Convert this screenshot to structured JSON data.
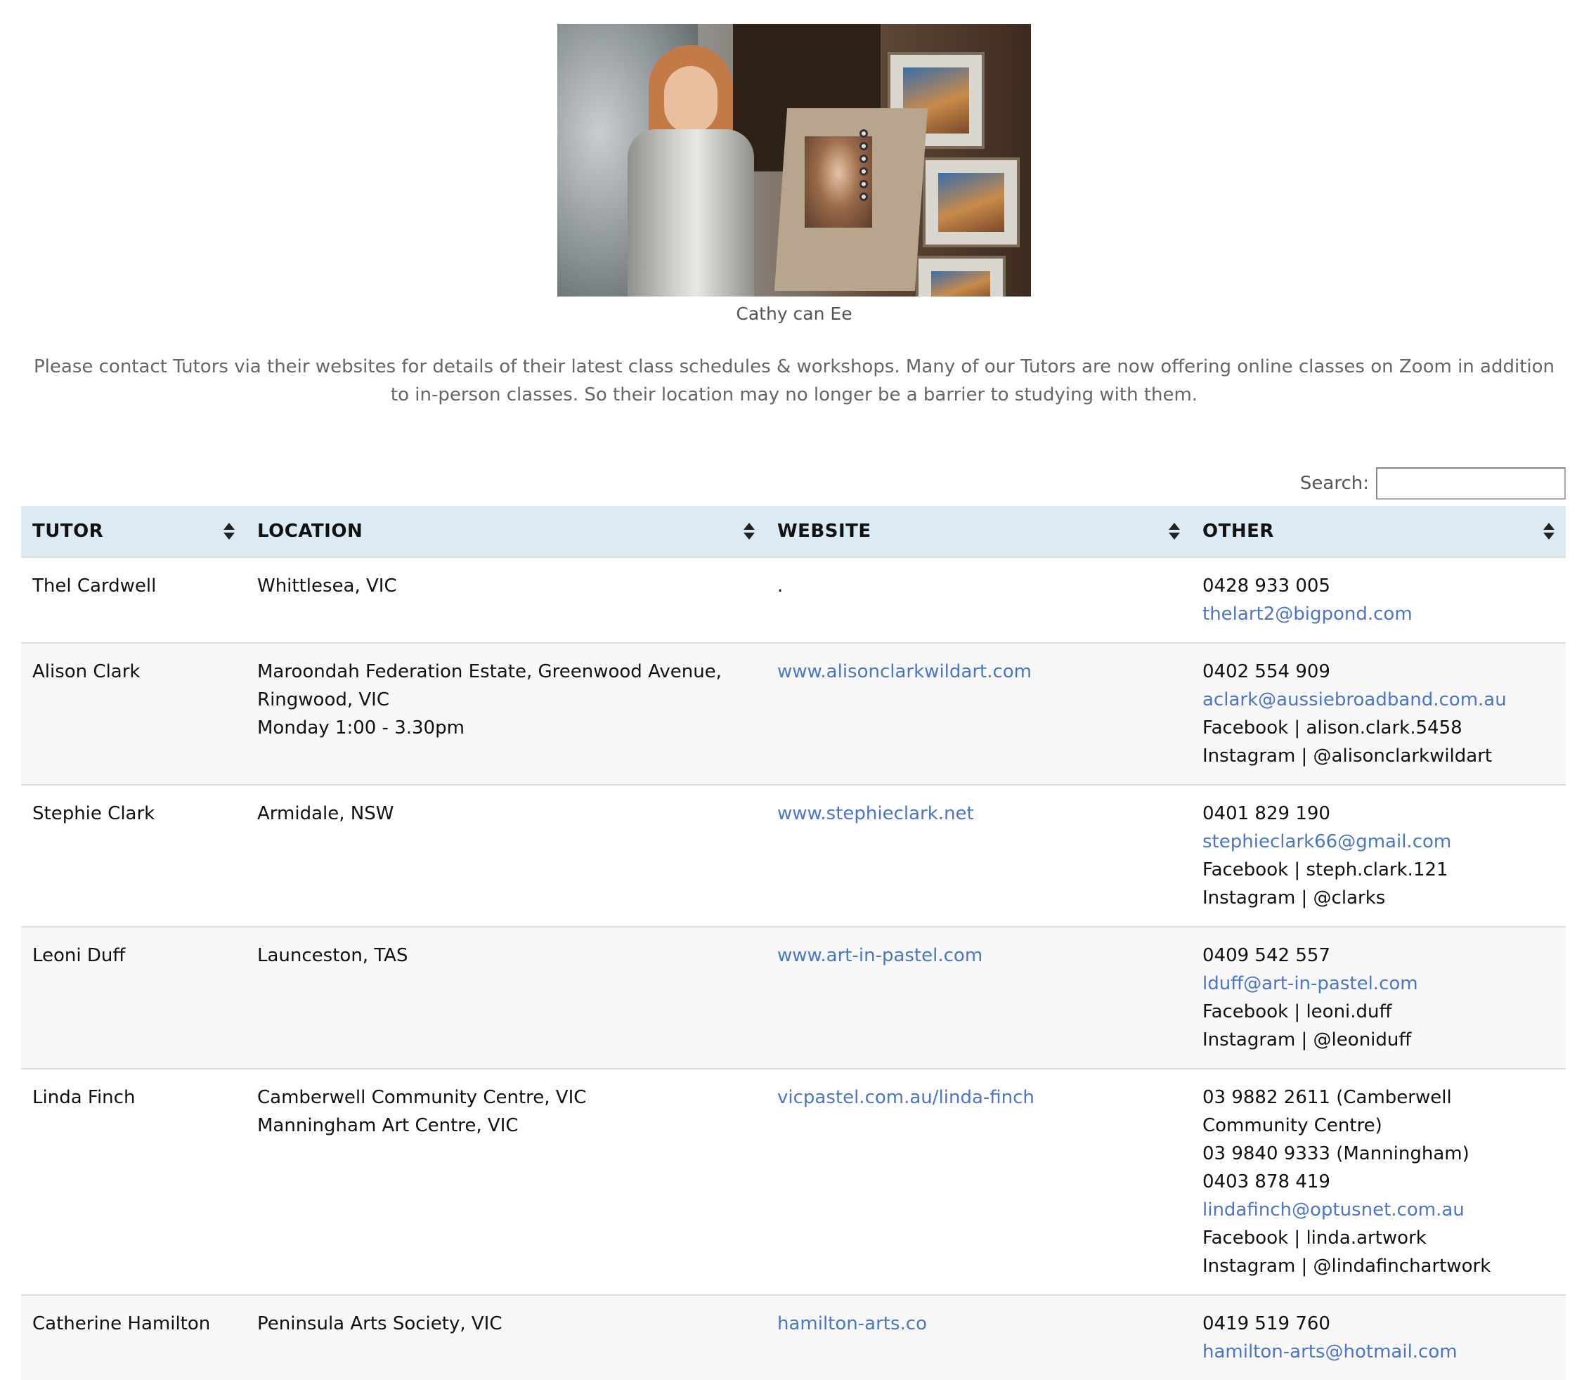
{
  "figure": {
    "caption": "Cathy can Ee"
  },
  "notice": "Please contact Tutors via their websites for details of their latest class schedules & workshops. Many of our Tutors are now offering online classes on Zoom in addition to in-person classes. So their location may no longer be a barrier to studying with them.",
  "search": {
    "label": "Search:",
    "value": ""
  },
  "table": {
    "headers": [
      "TUTOR",
      "LOCATION",
      "WEBSITE",
      "OTHER"
    ],
    "rows": [
      {
        "tutor": "Thel Cardwell",
        "location": [
          "Whittlesea, VIC"
        ],
        "website": ".",
        "website_is_link": false,
        "phone": [
          "0428 933 005"
        ],
        "email": "thelart2@bigpond.com",
        "social": []
      },
      {
        "tutor": "Alison Clark",
        "location": [
          "Maroondah Federation Estate, Greenwood Avenue, Ringwood, VIC",
          "Monday 1:00 - 3.30pm"
        ],
        "website": "www.alisonclarkwildart.com",
        "website_is_link": true,
        "phone": [
          "0402 554 909"
        ],
        "email": "aclark@aussiebroadband.com.au",
        "social": [
          "Facebook | alison.clark.5458",
          "Instagram | @alisonclarkwildart"
        ]
      },
      {
        "tutor": "Stephie Clark",
        "location": [
          "Armidale, NSW"
        ],
        "website": "www.stephieclark.net",
        "website_is_link": true,
        "phone": [
          "0401 829 190"
        ],
        "email": "stephieclark66@gmail.com",
        "social": [
          "Facebook | steph.clark.121",
          "Instagram | @clarks"
        ]
      },
      {
        "tutor": "Leoni Duff",
        "location": [
          "Launceston, TAS"
        ],
        "website": "www.art-in-pastel.com",
        "website_is_link": true,
        "phone": [
          "0409 542 557"
        ],
        "email": "lduff@art-in-pastel.com",
        "social": [
          "Facebook | leoni.duff",
          "Instagram | @leoniduff"
        ]
      },
      {
        "tutor": "Linda Finch",
        "location": [
          "Camberwell Community Centre, VIC",
          "Manningham Art Centre, VIC"
        ],
        "website": "vicpastel.com.au/linda-finch",
        "website_is_link": true,
        "phone": [
          "03 9882 2611 (Camberwell Community Centre)",
          "03 9840 9333 (Manningham)",
          "0403 878 419"
        ],
        "email": "lindafinch@optusnet.com.au",
        "social": [
          "Facebook | linda.artwork",
          "Instagram | @lindafinchartwork"
        ]
      },
      {
        "tutor": "Catherine Hamilton",
        "location": [
          "Peninsula Arts Society, VIC"
        ],
        "website": "hamilton-arts.co",
        "website_is_link": true,
        "phone": [
          "0419 519 760"
        ],
        "email": "hamilton-arts@hotmail.com",
        "social": []
      }
    ]
  },
  "colors": {
    "header_bg": "#dcebf3",
    "link": "#4a76c9",
    "muted_text": "#666666"
  }
}
